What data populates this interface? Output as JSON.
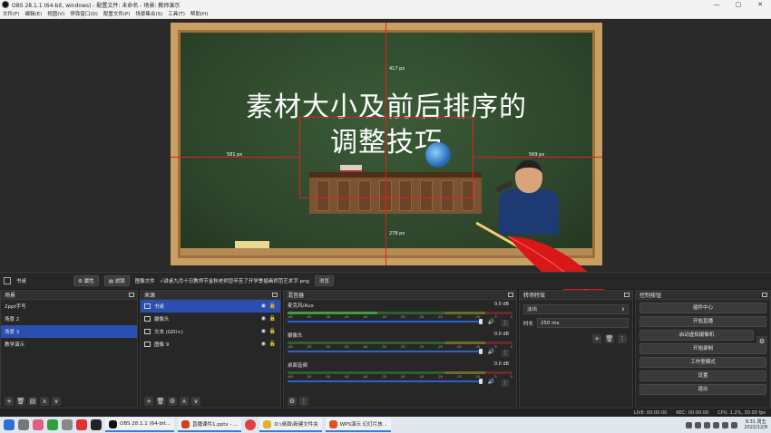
{
  "window": {
    "title": "OBS 28.1.1 (64-bit, windows) - 配置文件: 未命名 - 场景: 教师演示",
    "min": "—",
    "max": "▢",
    "close": "✕"
  },
  "menu": [
    "文件(F)",
    "编辑(E)",
    "视图(V)",
    "停靠窗口(D)",
    "配置文件(P)",
    "场景集合(S)",
    "工具(T)",
    "帮助(H)"
  ],
  "preview": {
    "title_line1": "素材大小及前后排序的",
    "title_line2": "调整技巧",
    "dim_top": "417 px",
    "dim_left": "581 px",
    "dim_right": "569 px",
    "dim_bottom": "278 px"
  },
  "source_bar": {
    "selected_source": "书桌",
    "properties": "属性",
    "filters": "滤镜",
    "image_file_label": "图像文件",
    "image_file_path": "√讲桌九月十日教师节金秋老师您辛苦了开学季插画师范艺术字.png",
    "browse": "浏览"
  },
  "scenes": {
    "header": "场景",
    "items": [
      "2ppt手写",
      "场景 2",
      "场景 3",
      "教学演示"
    ],
    "selected_index": 2
  },
  "sources": {
    "header": "来源",
    "items": [
      "书桌",
      "摄像头",
      "文本 (GDI+)",
      "图像 9"
    ],
    "selected_index": 0
  },
  "mixer": {
    "header": "混音器",
    "channels": [
      {
        "name": "麦克风/Aux",
        "db": "0.0 dB"
      },
      {
        "name": "摄像头",
        "db": "0.0 dB"
      },
      {
        "name": "桌面音频",
        "db": "0.0 dB"
      }
    ],
    "ticks": [
      "-60",
      "-55",
      "-50",
      "-45",
      "-40",
      "-35",
      "-30",
      "-25",
      "-20",
      "-15",
      "-10",
      "-5",
      "0"
    ]
  },
  "transitions": {
    "header": "转场特效",
    "selected": "淡出",
    "duration_label": "时长",
    "duration_value": "250 ms"
  },
  "controls": {
    "header": "控制按钮",
    "buttons": [
      "插件中心",
      "开始直播",
      "启动虚拟摄像机",
      "开始录制",
      "工作室模式",
      "设置",
      "退出"
    ]
  },
  "status": {
    "live": "LIVE: 00:00:00",
    "rec": "REC: 00:00:00",
    "cpu": "CPU: 1.2%, 30.00 fps"
  },
  "taskbar": {
    "apps": [
      {
        "label": "OBS 28.1.1 (64-bit...",
        "color": "#111111"
      },
      {
        "label": "直播课件1.pptx - ...",
        "color": "#d04020"
      },
      {
        "label": "D:\\桌面\\新建文件夹",
        "color": "#e0b030"
      },
      {
        "label": "WPS演示 幻灯片放...",
        "color": "#e05020"
      }
    ],
    "time": "9:31 周五",
    "date": "2022/12/9"
  },
  "colors": {
    "accent": "#2a4fb0",
    "selection_line": "#e02020",
    "board": "#2f4a2e"
  }
}
